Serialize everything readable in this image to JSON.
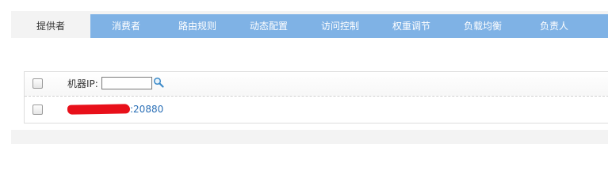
{
  "tabs": [
    {
      "label": "提供者",
      "active": true
    },
    {
      "label": "消费者",
      "active": false
    },
    {
      "label": "路由规则",
      "active": false
    },
    {
      "label": "动态配置",
      "active": false
    },
    {
      "label": "访问控制",
      "active": false
    },
    {
      "label": "权重调节",
      "active": false
    },
    {
      "label": "负载均衡",
      "active": false
    },
    {
      "label": "负责人",
      "active": false
    }
  ],
  "filter": {
    "ip_label": "机器IP:",
    "ip_value": "",
    "select_all_checked": false
  },
  "providers": [
    {
      "address": ":20880",
      "address_redacted": true,
      "checked": false
    }
  ],
  "colors": {
    "tab_bar": "#7fb2e5",
    "active_tab": "#f3f3f3",
    "link": "#2a6fb6",
    "redaction": "#e8101a"
  },
  "icons": {
    "search": "magnifier-icon"
  }
}
